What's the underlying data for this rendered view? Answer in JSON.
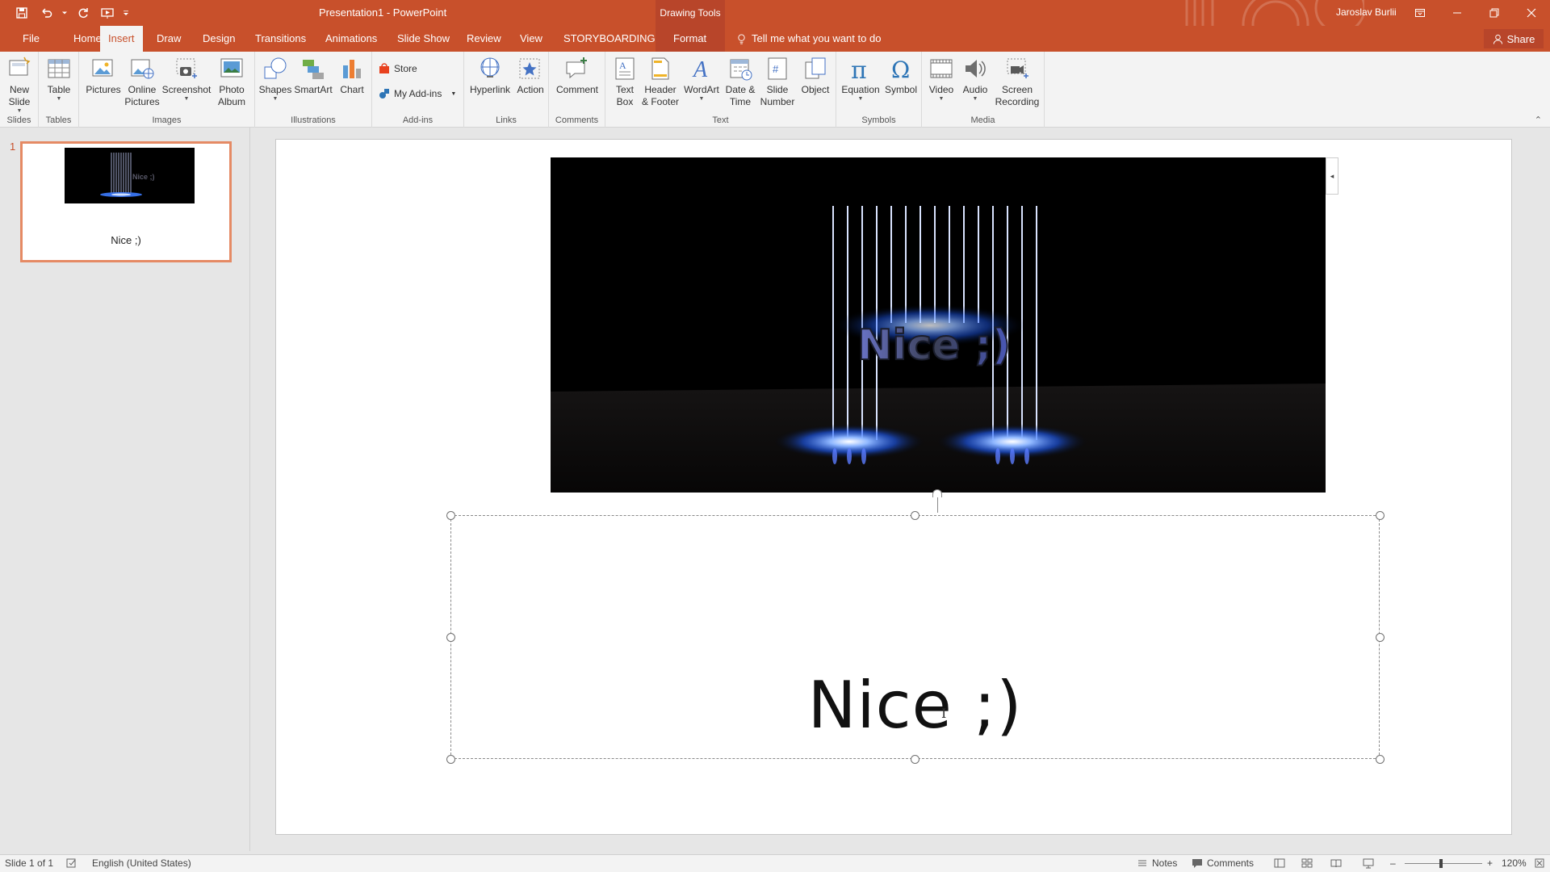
{
  "colors": {
    "accent": "#c8502b",
    "accent_dark": "#b8452a",
    "ribbon_bg": "#f3f3f3",
    "canvas_bg": "#e6e6e6",
    "thumb_border": "#e58a64",
    "glow": "#3c7bff"
  },
  "titlebar": {
    "title": "Presentation1 - PowerPoint",
    "context_group": "Drawing Tools",
    "user": "Jaroslav Burlii",
    "qat_icons": [
      "save-icon",
      "undo-icon",
      "redo-icon",
      "start-from-beginning-icon",
      "customize-qat-icon"
    ]
  },
  "tabs": [
    {
      "label": "File"
    },
    {
      "label": "Home"
    },
    {
      "label": "Insert"
    },
    {
      "label": "Draw"
    },
    {
      "label": "Design"
    },
    {
      "label": "Transitions"
    },
    {
      "label": "Animations"
    },
    {
      "label": "Slide Show"
    },
    {
      "label": "Review"
    },
    {
      "label": "View"
    },
    {
      "label": "STORYBOARDING"
    },
    {
      "label": "Format"
    }
  ],
  "active_tab": "Insert",
  "tell_me": "Tell me what you want to do",
  "share": "Share",
  "ribbon": {
    "groups": {
      "slides": "Slides",
      "tables": "Tables",
      "images": "Images",
      "illustrations": "Illustrations",
      "addins": "Add-ins",
      "links": "Links",
      "comments": "Comments",
      "text": "Text",
      "symbols": "Symbols",
      "media": "Media"
    },
    "buttons": {
      "new_slide_1": "New",
      "new_slide_2": "Slide",
      "table": "Table",
      "pictures": "Pictures",
      "online_pictures_1": "Online",
      "online_pictures_2": "Pictures",
      "screenshot": "Screenshot",
      "photo_album_1": "Photo",
      "photo_album_2": "Album",
      "shapes": "Shapes",
      "smartart": "SmartArt",
      "chart": "Chart",
      "store": "Store",
      "my_addins": "My Add-ins",
      "hyperlink": "Hyperlink",
      "action": "Action",
      "comment": "Comment",
      "text_box_1": "Text",
      "text_box_2": "Box",
      "header_footer_1": "Header",
      "header_footer_2": "& Footer",
      "wordart": "WordArt",
      "date_time_1": "Date &",
      "date_time_2": "Time",
      "slide_number_1": "Slide",
      "slide_number_2": "Number",
      "object": "Object",
      "equation": "Equation",
      "symbol": "Symbol",
      "video": "Video",
      "audio": "Audio",
      "screen_recording_1": "Screen",
      "screen_recording_2": "Recording"
    }
  },
  "thumbnails": [
    {
      "number": "1",
      "caption": "Nice ;)",
      "picture_text": "Nice ;)"
    }
  ],
  "slide": {
    "picture_text": "Nice ;)",
    "side_handle_glyph": "◂",
    "textbox_text": "Nice ;)"
  },
  "status": {
    "slide_info": "Slide 1 of 1",
    "language": "English (United States)",
    "notes": "Notes",
    "comments": "Comments",
    "zoom_minus": "–",
    "zoom_plus": "+",
    "zoom": "120%"
  }
}
